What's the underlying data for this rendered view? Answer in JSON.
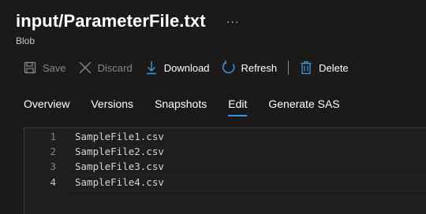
{
  "header": {
    "title": "input/ParameterFile.txt",
    "more": "···",
    "subtitle": "Blob"
  },
  "toolbar": {
    "save": {
      "label": "Save",
      "icon": "save-icon",
      "enabled": false
    },
    "discard": {
      "label": "Discard",
      "icon": "close-icon",
      "enabled": false
    },
    "download": {
      "label": "Download",
      "icon": "download-icon",
      "enabled": true
    },
    "refresh": {
      "label": "Refresh",
      "icon": "refresh-icon",
      "enabled": true
    },
    "delete": {
      "label": "Delete",
      "icon": "trash-icon",
      "enabled": true
    }
  },
  "tabs": [
    {
      "label": "Overview",
      "active": false
    },
    {
      "label": "Versions",
      "active": false
    },
    {
      "label": "Snapshots",
      "active": false
    },
    {
      "label": "Edit",
      "active": true
    },
    {
      "label": "Generate SAS",
      "active": false
    }
  ],
  "editor": {
    "current_line": 4,
    "lines": [
      {
        "number": "1",
        "text": "SampleFile1.csv"
      },
      {
        "number": "2",
        "text": "SampleFile2.csv"
      },
      {
        "number": "3",
        "text": "SampleFile3.csv"
      },
      {
        "number": "4",
        "text": "SampleFile4.csv"
      }
    ]
  },
  "colors": {
    "accent": "#2899f5",
    "icon_blue": "#3a96dd",
    "background": "#1b1a19",
    "editor_bg": "#1e1e1e"
  }
}
